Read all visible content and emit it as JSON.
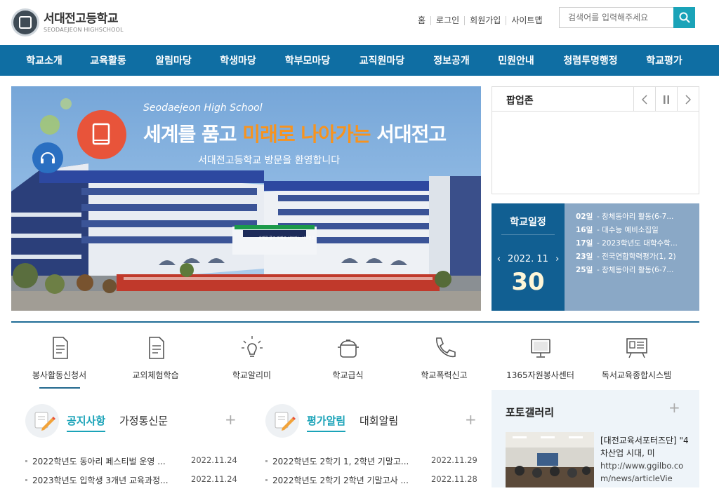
{
  "header": {
    "school_name": "서대전고등학교",
    "school_name_en": "SEODAEJEON HIGHSCHOOL",
    "util_links": [
      "홈",
      "로그인",
      "회원가입",
      "사이트맵"
    ],
    "search_placeholder": "검색어를 입력해주세요"
  },
  "gnb": [
    "학교소개",
    "교육활동",
    "알림마당",
    "학생마당",
    "학부모마당",
    "교직원마당",
    "정보공개",
    "민원안내",
    "청렴투명행정",
    "학교평가"
  ],
  "banner": {
    "eyebrow": "Seodaejeon High School",
    "headline_1": "세계를 품고 ",
    "headline_2": "미래로 나아가는",
    "headline_3": " 서대전고",
    "subtitle": "서대전고등학교 방문을 환영합니다",
    "building_sign": "세계를 품고 미래로 나아가는 서대전고"
  },
  "popup": {
    "title": "팝업존",
    "prev_icon": "chevron-left-icon",
    "pause_icon": "pause-icon",
    "next_icon": "chevron-right-icon"
  },
  "schedule": {
    "title": "학교일정",
    "month": "2022. 11",
    "day": "30",
    "events": [
      {
        "day": "02일",
        "text": "- 창체동아리 활동(6-7..."
      },
      {
        "day": "16일",
        "text": "- 대수능 예비소집일"
      },
      {
        "day": "17일",
        "text": "- 2023학년도 대학수학..."
      },
      {
        "day": "23일",
        "text": "- 전국연합학력평가(1, 2)"
      },
      {
        "day": "25일",
        "text": "- 창체동아리 활동(6-7..."
      }
    ]
  },
  "quick_links": [
    {
      "label": "봉사활동신청서",
      "icon": "document-icon"
    },
    {
      "label": "교외체험학습",
      "icon": "document-icon"
    },
    {
      "label": "학교알리미",
      "icon": "lightbulb-icon"
    },
    {
      "label": "학교급식",
      "icon": "pot-icon"
    },
    {
      "label": "학교폭력신고",
      "icon": "phone-icon"
    },
    {
      "label": "1365자원봉사센터",
      "icon": "monitor-icon"
    },
    {
      "label": "독서교육종합시스템",
      "icon": "board-icon"
    }
  ],
  "notice": {
    "tab_active": "공지사항",
    "tab_other": "가정통신문",
    "items": [
      {
        "title": "2022학년도 동아리 페스티벌 운영 ...",
        "date": "2022.11.24"
      },
      {
        "title": "2023학년도 입학생 3개년 교육과정...",
        "date": "2022.11.24"
      }
    ]
  },
  "evaluation": {
    "tab_active": "평가알림",
    "tab_other": "대회알림",
    "items": [
      {
        "title": "2022학년도 2학기 1, 2학년 기말고...",
        "date": "2022.11.29"
      },
      {
        "title": "2022학년도 2학기 2학년 기말고사 ...",
        "date": "2022.11.28"
      }
    ]
  },
  "gallery": {
    "title": "포토갤러리",
    "caption": "[대전교육서포터즈단] \"4차산업 시대, 미",
    "url": "http://www.ggilbo.com/news/articleVie"
  },
  "colors": {
    "nav_bg": "#0f6ea3",
    "accent": "#1aa3b8",
    "schedule_dark": "#115f92",
    "headline_orange": "#f7931e"
  }
}
